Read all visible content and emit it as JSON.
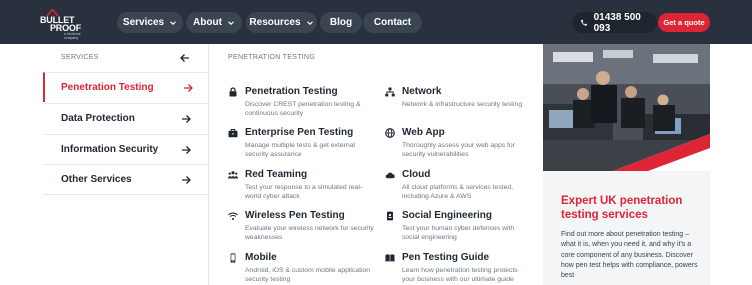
{
  "logo": {
    "line1": "BULLET",
    "line2": "PROOF",
    "tagline": "a Ventcore company"
  },
  "nav": {
    "services": "Services",
    "about": "About",
    "resources": "Resources",
    "blog": "Blog",
    "contact": "Contact",
    "phone": "01438 500 093",
    "quote": "Get a quote"
  },
  "sidebar": {
    "heading": "SERVICES",
    "items": [
      {
        "label": "Penetration Testing",
        "active": true
      },
      {
        "label": "Data Protection"
      },
      {
        "label": "Information Security"
      },
      {
        "label": "Other Services"
      }
    ]
  },
  "main": {
    "heading": "PENETRATION TESTING",
    "services": [
      {
        "title": "Penetration Testing",
        "icon": "lock-icon",
        "desc": "Discover CREST penetration testing & continuous security"
      },
      {
        "title": "Network",
        "icon": "network-icon",
        "desc": "Network & infrastructure security testing"
      },
      {
        "title": "Enterprise Pen Testing",
        "icon": "briefcase-icon",
        "desc": "Manage multiple tests & get external security assurance"
      },
      {
        "title": "Web App",
        "icon": "globe-icon",
        "desc": "Thoroughly assess your web apps for security vulnerabilities"
      },
      {
        "title": "Red Teaming",
        "icon": "users-icon",
        "desc": "Test your response to a simulated real-world cyber attack"
      },
      {
        "title": "Cloud",
        "icon": "cloud-icon",
        "desc": "All cloud platforms & services tested, including Azure & AWS"
      },
      {
        "title": "Wireless Pen Testing",
        "icon": "wifi-icon",
        "desc": "Evaluate your wireless network for security weaknesses"
      },
      {
        "title": "Social Engineering",
        "icon": "id-badge-icon",
        "desc": "Test your human cyber defences with social engineering"
      },
      {
        "title": "Mobile",
        "icon": "mobile-icon",
        "desc": "Android, iOS & custom mobile application security testing"
      },
      {
        "title": "Pen Testing Guide",
        "icon": "book-icon",
        "desc": "Learn how penetration testing protects your business with our ultimate guide"
      }
    ]
  },
  "panel": {
    "title": "Expert UK penetration testing services",
    "text": "Find out more about penetration testing – what it is, when you need it, and why it's a core component of any business. Discover how pen test helps with compliance, powers best"
  },
  "colors": {
    "nav_bg": "#28313d",
    "accent": "#dd2535",
    "panel_bg": "#f4f5f6"
  }
}
